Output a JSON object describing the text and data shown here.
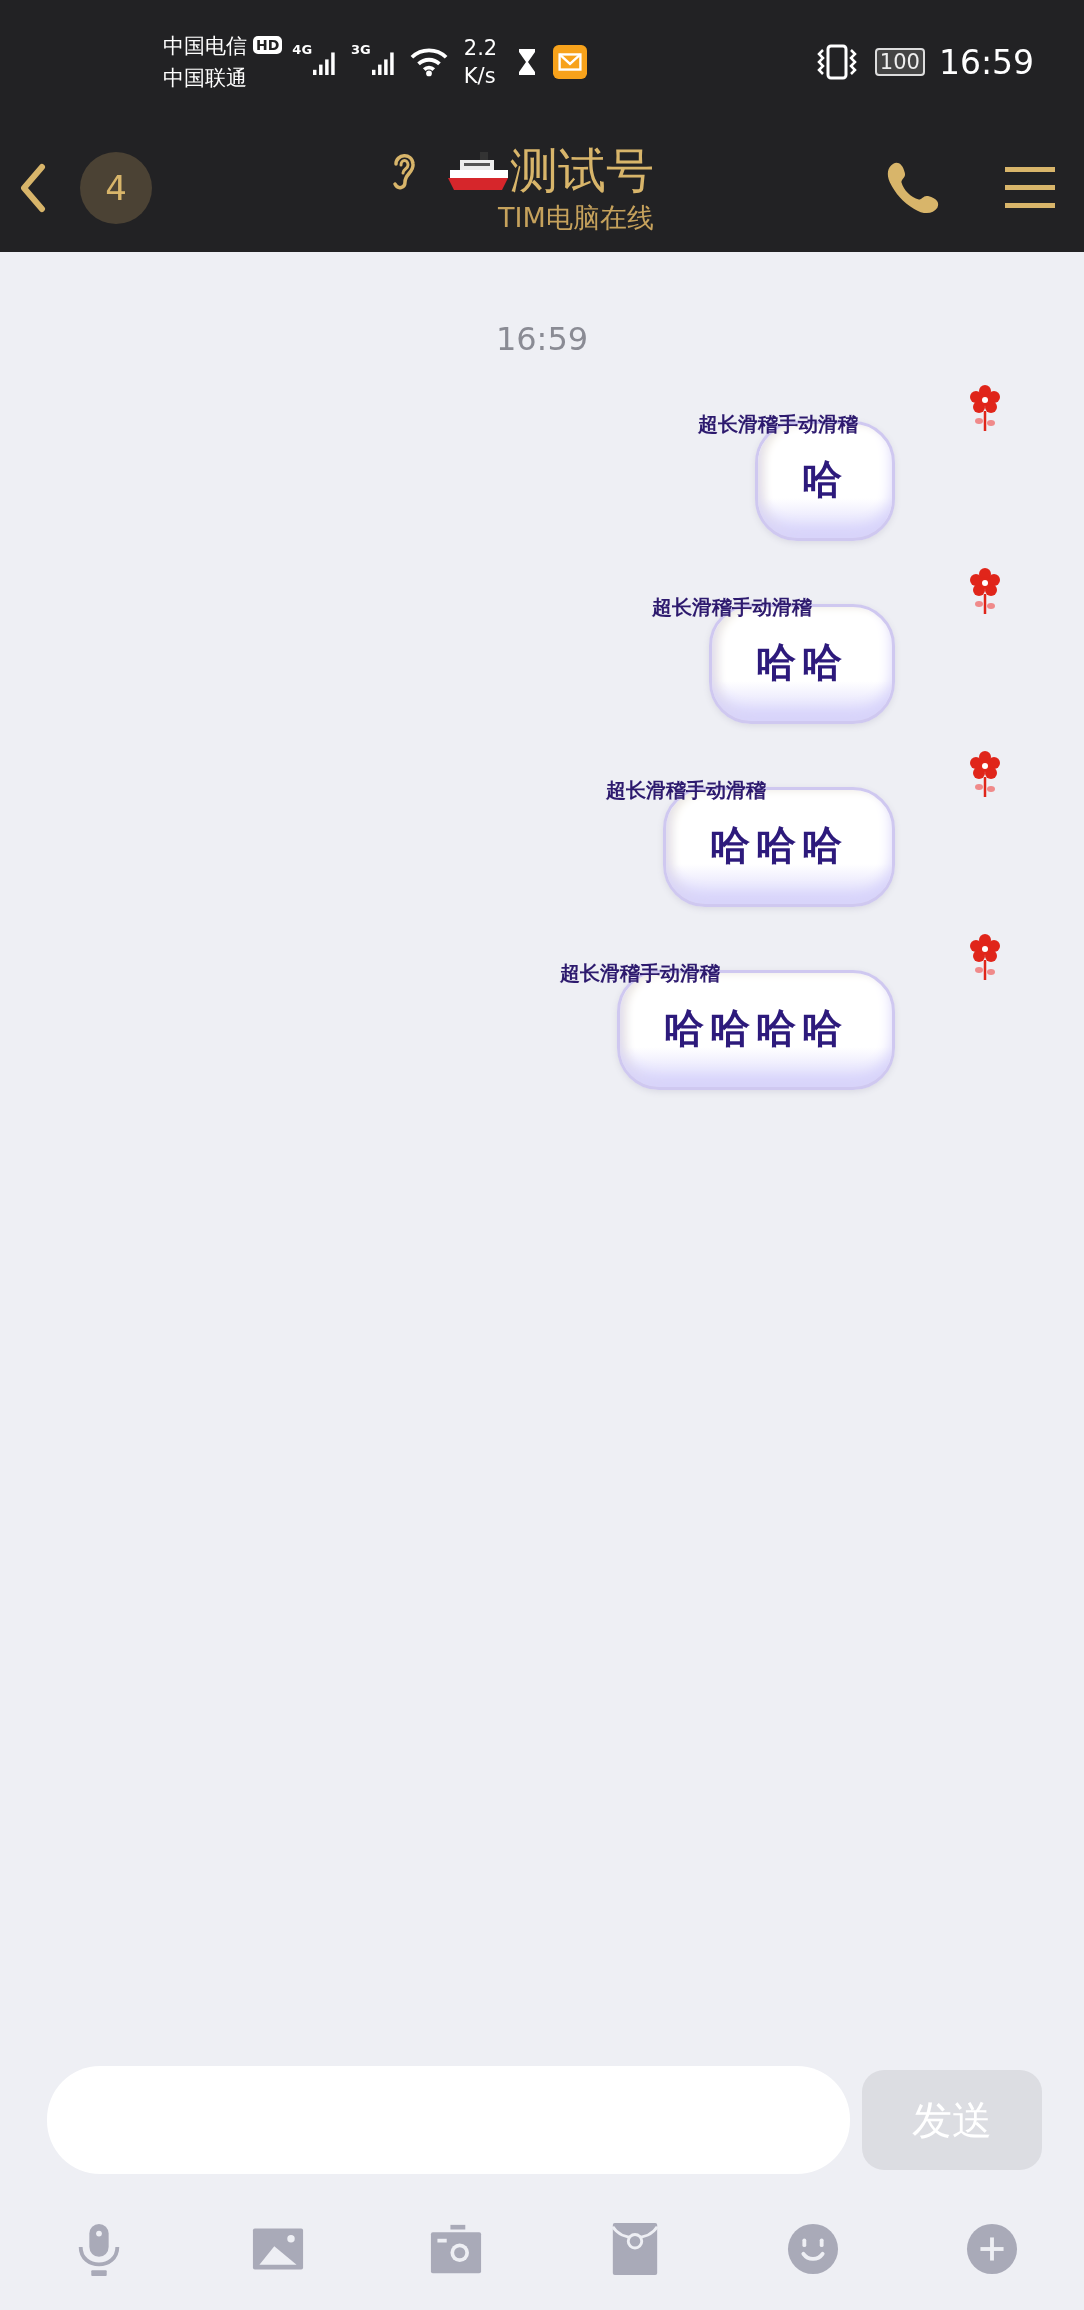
{
  "status_bar": {
    "carriers": [
      "中国电信",
      "中国联通"
    ],
    "hd": "HD",
    "networks": [
      "4G",
      "3G"
    ],
    "speed": [
      "2.2",
      "K/s"
    ],
    "battery": "100",
    "time": "16:59"
  },
  "header": {
    "unread_count": "4",
    "title": "测试号",
    "subtitle": "TIM电脑在线"
  },
  "chat": {
    "timestamp": "16:59",
    "messages": [
      {
        "sender": "超长滑稽手动滑稽",
        "text": "哈"
      },
      {
        "sender": "超长滑稽手动滑稽",
        "text": "哈哈"
      },
      {
        "sender": "超长滑稽手动滑稽",
        "text": "哈哈哈"
      },
      {
        "sender": "超长滑稽手动滑稽",
        "text": "哈哈哈哈"
      }
    ]
  },
  "composer": {
    "send_label": "发送"
  }
}
